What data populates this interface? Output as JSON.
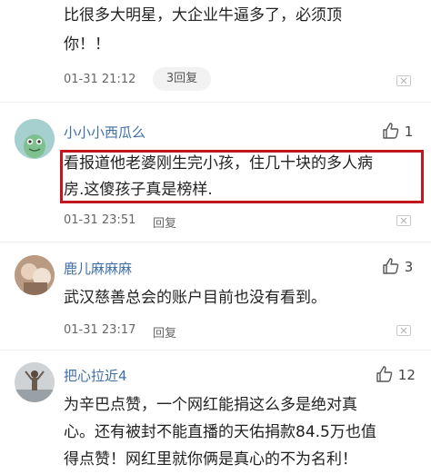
{
  "comments": [
    {
      "text_lines": [
        "比很多大明星，大企业牛逼多了，必须顶",
        "你！！"
      ],
      "time": "01-31 21:12",
      "reply_label": "3回复"
    },
    {
      "username": "小小小西瓜么",
      "likes": "1",
      "text_lines": [
        "看报道他老婆刚生完小孩，住几十块的多人病",
        "房.这傻孩子真是榜样."
      ],
      "time": "01-31 23:51",
      "reply_label": "回复"
    },
    {
      "username": "鹿儿麻麻麻",
      "likes": "3",
      "text_lines": [
        "武汉慈善总会的账户目前也没有看到。"
      ],
      "time": "01-31 23:17",
      "reply_label": "回复"
    },
    {
      "username": "把心拉近4",
      "likes": "12",
      "text_lines": [
        "为辛巴点赞，一个网红能捐这么多是绝对真",
        "心。还有被封不能直播的天佑捐款84.5万也值",
        "得点赞！网红里就你俩是真心的不为名利！"
      ]
    }
  ],
  "colors": {
    "username": "#3f6fa6",
    "highlight_border": "#c0181e"
  }
}
